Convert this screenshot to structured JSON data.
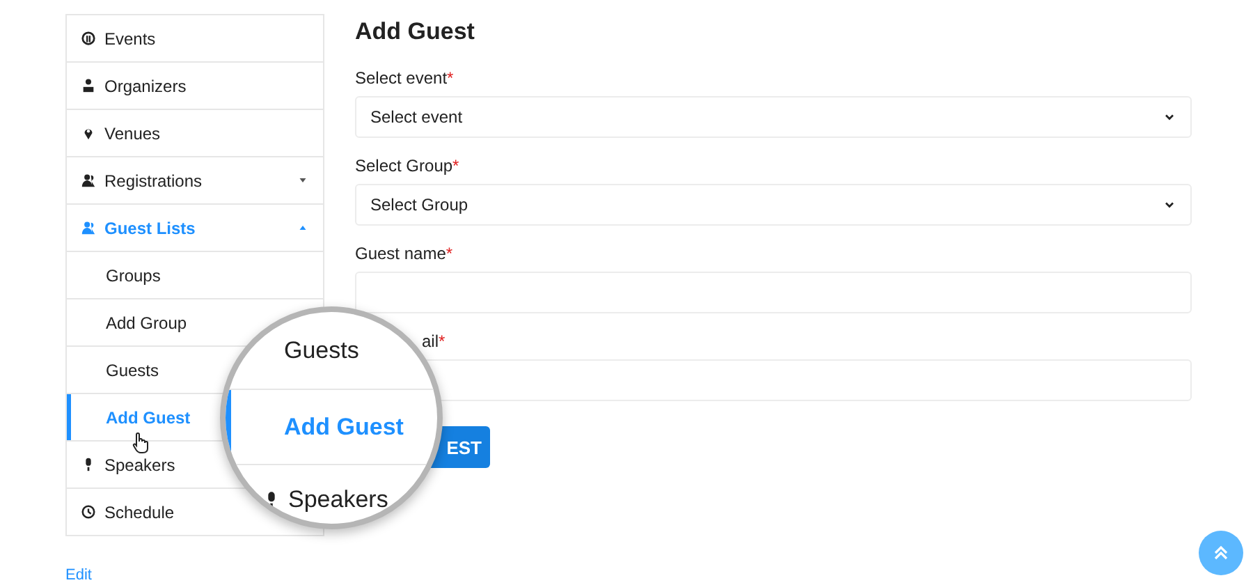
{
  "sidebar": {
    "items": [
      {
        "kind": "menu",
        "label": "Events",
        "selected": false
      },
      {
        "kind": "menu",
        "label": "Organizers",
        "selected": false
      },
      {
        "kind": "menu",
        "label": "Venues",
        "selected": false
      },
      {
        "kind": "menu",
        "label": "Registrations",
        "selected": false,
        "expanded": false
      },
      {
        "kind": "menu",
        "label": "Guest Lists",
        "selected": true,
        "expanded": true
      },
      {
        "kind": "submenu",
        "label": "Groups",
        "selected": false
      },
      {
        "kind": "submenu",
        "label": "Add Group",
        "selected": false
      },
      {
        "kind": "submenu",
        "label": "Guests",
        "selected": false
      },
      {
        "kind": "submenu",
        "label": "Add Guest",
        "selected": true
      },
      {
        "kind": "menu",
        "label": "Speakers",
        "selected": false
      },
      {
        "kind": "menu",
        "label": "Schedule",
        "selected": false
      }
    ]
  },
  "edit_link": "Edit",
  "form": {
    "title": "Add Guest",
    "fields": [
      {
        "kind": "select",
        "label": "Select event",
        "required": true,
        "required_mark": "*",
        "value": "Select event"
      },
      {
        "kind": "select",
        "label": "Select Group",
        "required": true,
        "required_mark": "*",
        "value": "Select Group"
      },
      {
        "kind": "text",
        "label": "Guest name",
        "required": true,
        "required_mark": "*"
      },
      {
        "kind": "text",
        "label": "ail",
        "required": true,
        "required_mark": "*"
      }
    ],
    "button": "EST"
  },
  "magnifier": {
    "items": [
      {
        "kind": "submenu",
        "label": "Guests",
        "selected": false
      },
      {
        "kind": "submenu",
        "label": "Add Guest",
        "selected": true
      },
      {
        "kind": "menu",
        "label": "Speakers",
        "selected": false
      }
    ]
  }
}
